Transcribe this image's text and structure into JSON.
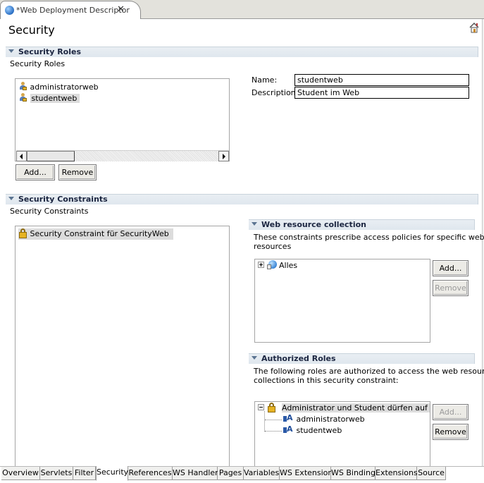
{
  "editor": {
    "tab_title": "*Web Deployment Descriptor",
    "close_symbol": "✕"
  },
  "page": {
    "title": "Security"
  },
  "security_roles": {
    "section_title": "Security Roles",
    "description": "Security Roles",
    "roles": [
      "administratorweb",
      "studentweb"
    ],
    "selected_role": "studentweb",
    "add_label": "Add...",
    "remove_label": "Remove",
    "name_label": "Name:",
    "name_value": "studentweb",
    "description_label": "Description:",
    "description_value": "Student im Web"
  },
  "security_constraints": {
    "section_title": "Security Constraints",
    "description": "Security Constraints",
    "items": [
      "Security Constraint für SecurityWeb"
    ]
  },
  "web_resource_collection": {
    "section_title": "Web resource collection",
    "description_line1": "These constraints prescribe access policies for specific web",
    "description_line2": "resources",
    "items": [
      "Alles"
    ],
    "add_label": "Add...",
    "remove_label": "Remove"
  },
  "authorized_roles": {
    "section_title": "Authorized Roles",
    "description_line1": "The following roles are authorized to access the web resource",
    "description_line2": "collections in this security constraint:",
    "root": "Administrator und Student dürfen auf diese",
    "children": [
      "administratorweb",
      "studentweb"
    ],
    "add_label": "Add...",
    "remove_label": "Remove"
  },
  "page_tabs": [
    "Overview",
    "Servlets",
    "Filter",
    "Security",
    "References",
    "WS Handler",
    "Pages",
    "Variables",
    "WS Extension",
    "WS Binding",
    "Extensions",
    "Source"
  ],
  "active_page_tab": "Security"
}
